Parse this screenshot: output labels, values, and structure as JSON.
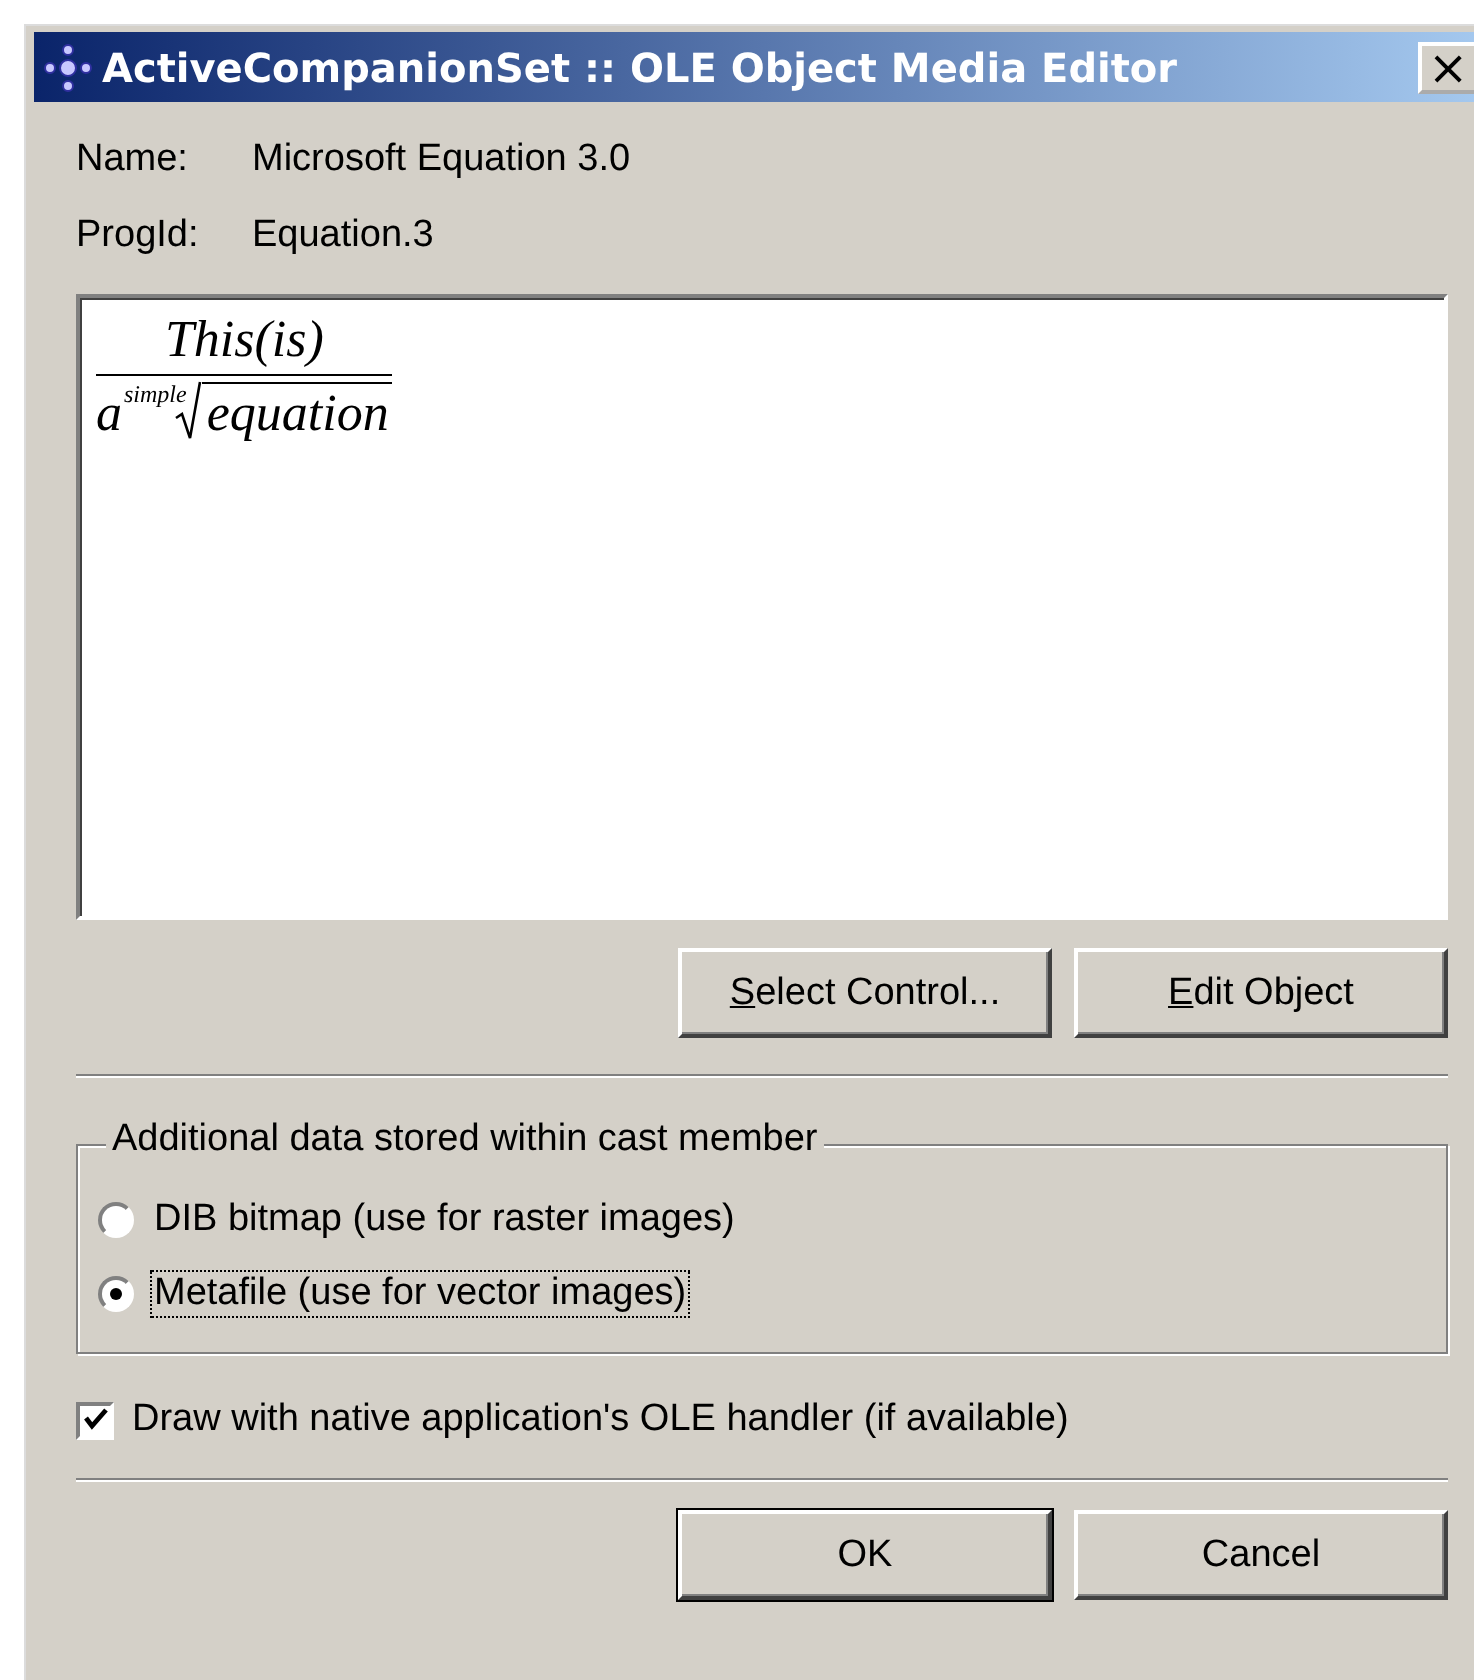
{
  "window": {
    "title": "ActiveCompanionSet :: OLE Object Media Editor",
    "close": "×"
  },
  "info": [
    {
      "label": "Name:",
      "value": "Microsoft Equation 3.0"
    },
    {
      "label": "ProgId:",
      "value": "Equation.3"
    }
  ],
  "preview": {
    "numerator": "This(is)",
    "base": "a",
    "index": "simple",
    "radicand": "equation"
  },
  "object_buttons": [
    {
      "accel": "S",
      "label": "elect Control..."
    },
    {
      "accel": "E",
      "label": "dit Object"
    }
  ],
  "group": {
    "legend": "Additional data stored within cast member",
    "options": [
      {
        "label": "DIB bitmap (use for raster images)",
        "selected": false,
        "focused": false
      },
      {
        "label": "Metafile (use for vector images)",
        "selected": true,
        "focused": true
      }
    ]
  },
  "checkbox": {
    "label": "Draw with native application's OLE handler (if available)",
    "checked": true
  },
  "dialog_buttons": [
    {
      "label": "OK",
      "default": true
    },
    {
      "label": "Cancel",
      "default": false
    }
  ]
}
